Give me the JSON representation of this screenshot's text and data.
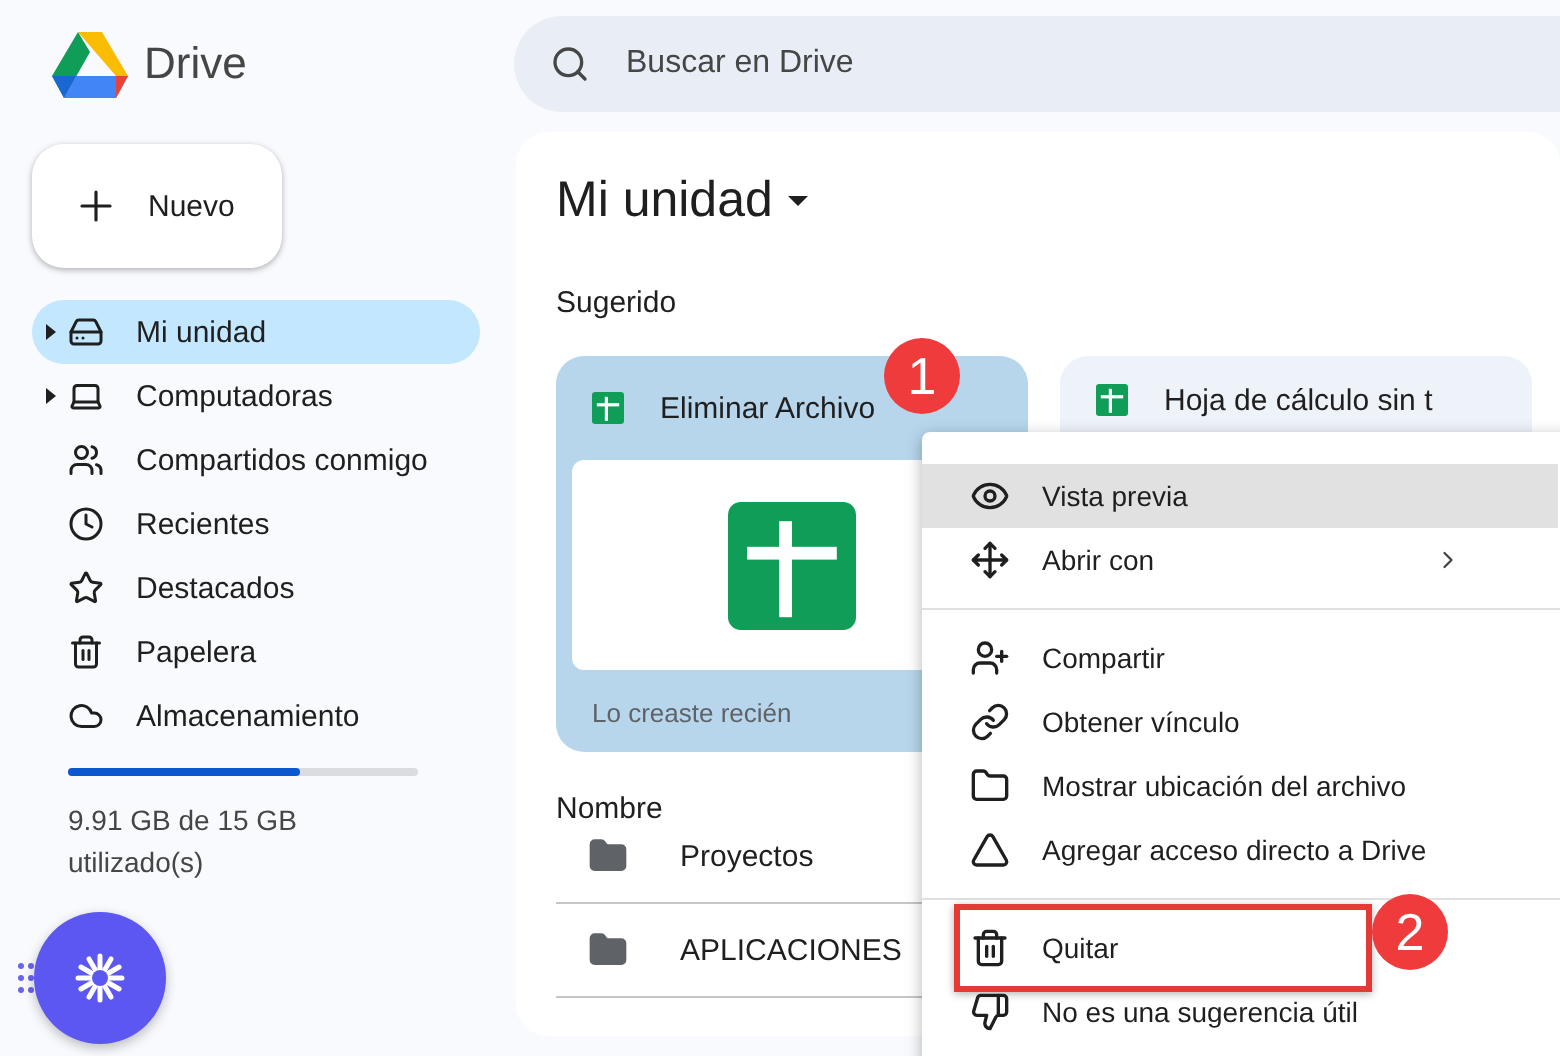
{
  "app": {
    "name": "Drive"
  },
  "search": {
    "placeholder": "Buscar en Drive"
  },
  "new_button": {
    "label": "Nuevo"
  },
  "sidebar": {
    "items": [
      {
        "label": "Mi unidad",
        "selected": true,
        "expandable": true
      },
      {
        "label": "Computadoras",
        "selected": false,
        "expandable": true
      },
      {
        "label": "Compartidos conmigo",
        "selected": false,
        "expandable": false
      },
      {
        "label": "Recientes",
        "selected": false,
        "expandable": false
      },
      {
        "label": "Destacados",
        "selected": false,
        "expandable": false
      },
      {
        "label": "Papelera",
        "selected": false,
        "expandable": false
      },
      {
        "label": "Almacenamiento",
        "selected": false,
        "expandable": false
      }
    ],
    "storage": {
      "level": 0.66,
      "text": "9.91 GB de 15 GB utilizado(s)"
    }
  },
  "main": {
    "title": "Mi unidad",
    "section": "Sugerido",
    "cards": [
      {
        "title": "Eliminar Archivo",
        "subtitle": "Lo creaste recién",
        "selected": true
      },
      {
        "title": "Hoja de cálculo sin t",
        "selected": false
      }
    ],
    "list_header": "Nombre",
    "rows": [
      {
        "name": "Proyectos"
      },
      {
        "name": "APLICACIONES"
      }
    ]
  },
  "context_menu": {
    "sections": [
      [
        {
          "label": "Vista previa",
          "selected": true,
          "submenu": false,
          "highlighted": false
        },
        {
          "label": "Abrir con",
          "selected": false,
          "submenu": true,
          "highlighted": false
        }
      ],
      [
        {
          "label": "Compartir",
          "selected": false,
          "submenu": false,
          "highlighted": false
        },
        {
          "label": "Obtener vínculo",
          "selected": false,
          "submenu": false,
          "highlighted": false
        },
        {
          "label": "Mostrar ubicación del archivo",
          "selected": false,
          "submenu": false,
          "highlighted": false
        },
        {
          "label": "Agregar acceso directo a Drive",
          "selected": false,
          "submenu": false,
          "highlighted": false
        }
      ],
      [
        {
          "label": "Quitar",
          "selected": false,
          "submenu": false,
          "highlighted": true
        },
        {
          "label": "No es una sugerencia útil",
          "selected": false,
          "submenu": false,
          "highlighted": false
        }
      ]
    ]
  },
  "annotations": [
    {
      "number": "1"
    },
    {
      "number": "2"
    }
  ]
}
